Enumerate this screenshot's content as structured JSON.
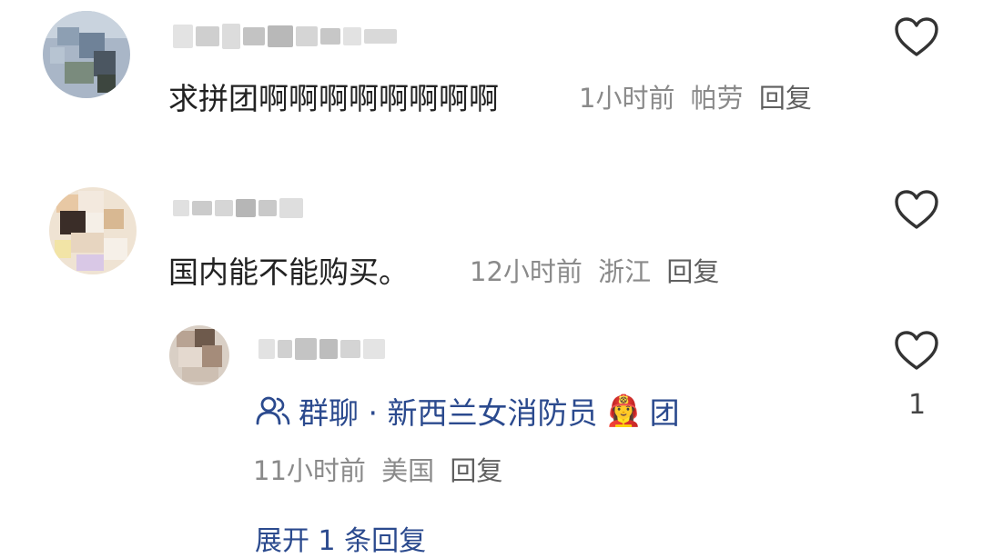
{
  "comments": [
    {
      "text": "求拼团啊啊啊啊啊啊啊啊",
      "time": "1小时前",
      "location": "帕劳",
      "reply_label": "回复"
    },
    {
      "text": "国内能不能购买。",
      "time": "12小时前",
      "location": "浙江",
      "reply_label": "回复"
    }
  ],
  "reply": {
    "group_prefix": "群聊 · 新西兰女消防员",
    "group_emoji": "👩‍🚒",
    "group_suffix": "团",
    "time": "11小时前",
    "location": "美国",
    "reply_label": "回复",
    "like_count": "1"
  },
  "expand_label": "展开 1 条回复",
  "icons": {
    "like": "heart-outline-icon",
    "group": "group-users-icon",
    "emoji": "firefighter-emoji"
  },
  "colors": {
    "text": "#222222",
    "meta": "#8a8a8a",
    "link": "#2b4a8e",
    "heart": "#333333"
  }
}
